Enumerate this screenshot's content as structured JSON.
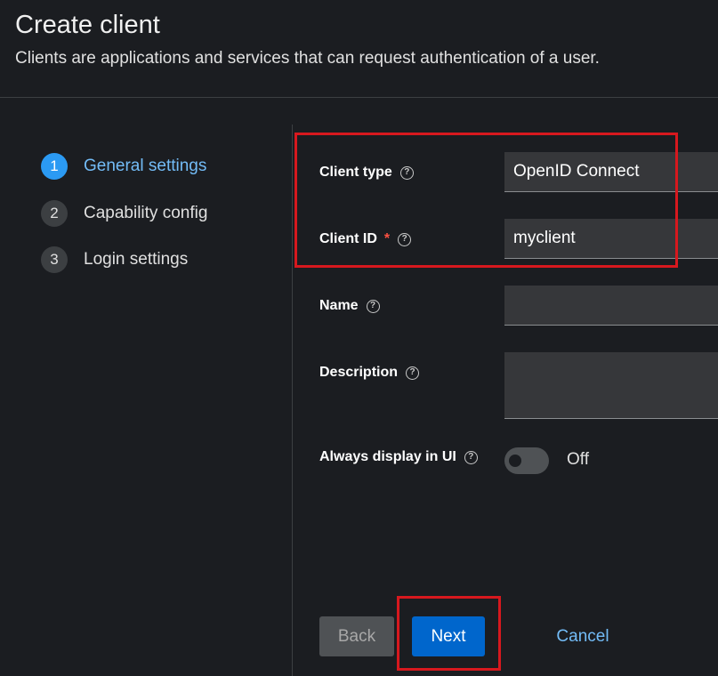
{
  "header": {
    "title": "Create client",
    "subtitle": "Clients are applications and services that can request authentication of a user."
  },
  "wizard": {
    "steps": [
      {
        "number": "1",
        "label": "General settings",
        "active": true
      },
      {
        "number": "2",
        "label": "Capability config",
        "active": false
      },
      {
        "number": "3",
        "label": "Login settings",
        "active": false
      }
    ]
  },
  "form": {
    "client_type": {
      "label": "Client type",
      "value": "OpenID Connect"
    },
    "client_id": {
      "label": "Client ID",
      "required_mark": "*",
      "value": "myclient"
    },
    "name": {
      "label": "Name",
      "value": ""
    },
    "description": {
      "label": "Description",
      "value": ""
    },
    "always_display": {
      "label": "Always display in UI",
      "state_text": "Off",
      "checked": false
    },
    "help_glyph": "?"
  },
  "actions": {
    "back_label": "Back",
    "next_label": "Next",
    "cancel_label": "Cancel"
  },
  "colors": {
    "background": "#1b1d21",
    "accent": "#0066cc",
    "active_step": "#2b9af3",
    "link": "#73bcf7",
    "annotation": "#d7181e"
  },
  "icons": {
    "help": "help-icon"
  }
}
